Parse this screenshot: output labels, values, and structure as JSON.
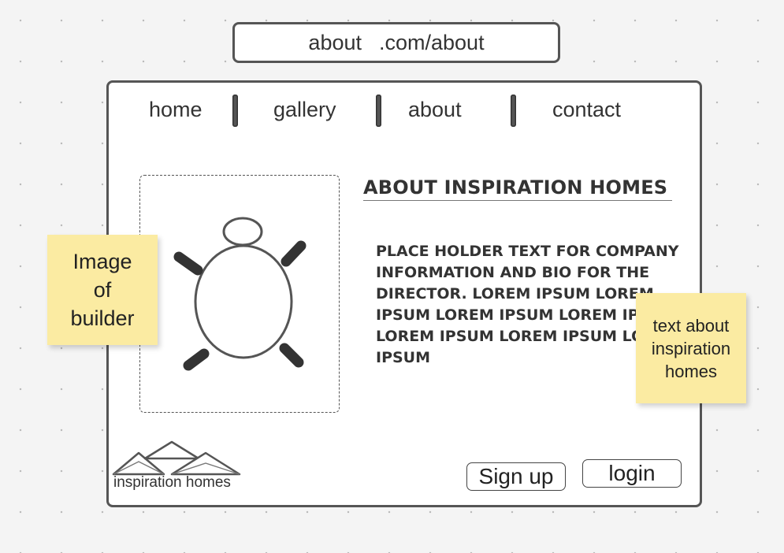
{
  "url_bar": {
    "page": "about",
    "path": ".com/about"
  },
  "nav": {
    "items": [
      {
        "label": "home"
      },
      {
        "label": "gallery"
      },
      {
        "label": "about"
      },
      {
        "label": "contact"
      }
    ]
  },
  "content": {
    "heading": "ABOUT INSPIRATION HOMES",
    "body": "PLACE HOLDER TEXT FOR COMPANY INFORMATION AND BIO FOR THE DIRECTOR. LOREM IPSUM LOREM IPSUM LOREM IPSUM LOREM IPSUM LOREM IPSUM LOREM IPSUM LOREM IPSUM"
  },
  "image_placeholder": {
    "icon": "person-placeholder-icon"
  },
  "stickies": {
    "left": [
      "Image",
      "of",
      "builder"
    ],
    "right": [
      "text about",
      "inspiration",
      "homes"
    ]
  },
  "logo": {
    "icon": "mountains-logo-icon",
    "label": "inspiration homes"
  },
  "buttons": {
    "signup": "Sign up",
    "login": "login"
  },
  "colors": {
    "sticky": "#fbeba2",
    "stroke": "#555555",
    "canvas": "#f4f4f4"
  }
}
